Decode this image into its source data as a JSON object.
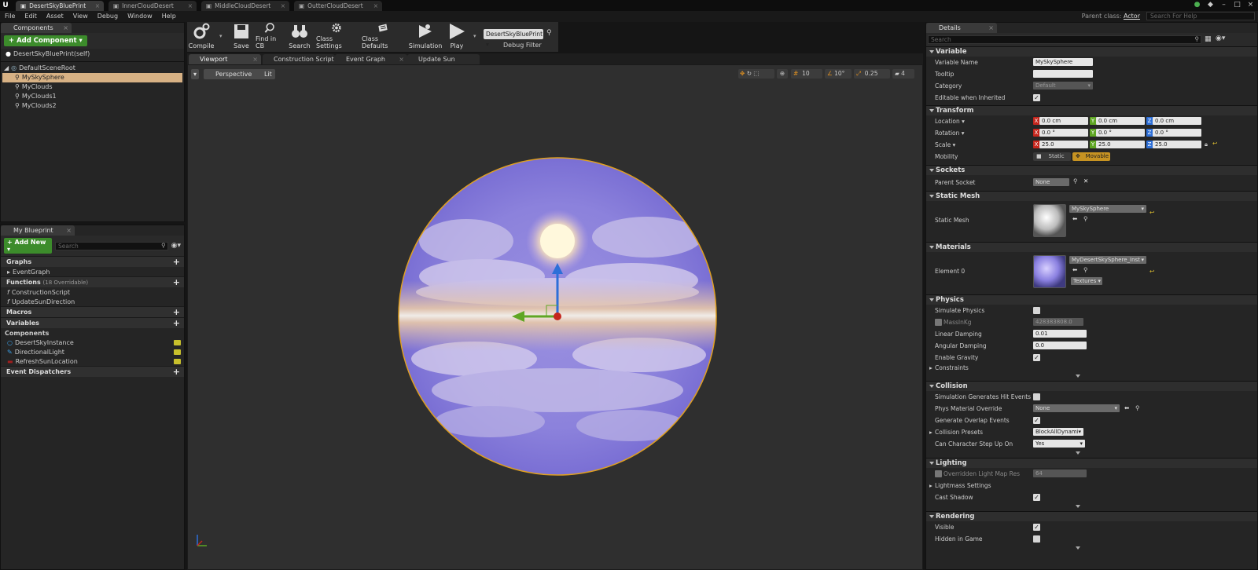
{
  "app": {
    "logo": "U"
  },
  "doc_tabs": [
    {
      "label": "DesertSkyBluePrint",
      "active": true
    },
    {
      "label": "InnerCloudDesert",
      "active": false
    },
    {
      "label": "MiddleCloudDesert",
      "active": false
    },
    {
      "label": "OutterCloudDesert",
      "active": false
    }
  ],
  "menu": [
    "File",
    "Edit",
    "Asset",
    "View",
    "Debug",
    "Window",
    "Help"
  ],
  "parent_class": {
    "label": "Parent class:",
    "value": "Actor"
  },
  "help_search_placeholder": "Search For Help",
  "components": {
    "tab": "Components",
    "add_button": "+ Add Component ▾",
    "self_item": "DesertSkyBluePrint(self)",
    "root": "DefaultSceneRoot",
    "children": [
      "MySkySphere",
      "MyClouds",
      "MyClouds1",
      "MyClouds2"
    ],
    "selected": "MySkySphere"
  },
  "blueprint": {
    "tab": "My Blueprint",
    "add_new": "+ Add New ▾",
    "search_placeholder": "Search",
    "graphs_label": "Graphs",
    "event_graph": "EventGraph",
    "functions_label": "Functions",
    "functions_note": "(18 Overridable)",
    "functions": [
      "ConstructionScript",
      "UpdateSunDirection"
    ],
    "macros_label": "Macros",
    "variables_label": "Variables",
    "components_group": "Components",
    "variables": [
      "DesertSkyInstance",
      "DirectionalLight",
      "RefreshSunLocation"
    ],
    "dispatchers_label": "Event Dispatchers"
  },
  "toolbar": {
    "compile": "Compile",
    "save": "Save",
    "find_in_cb": "Find in CB",
    "search": "Search",
    "class_settings": "Class Settings",
    "class_defaults": "Class Defaults",
    "simulation": "Simulation",
    "play": "Play",
    "debug_object": "DesertSkyBluePrint ▾",
    "debug_filter": "Debug Filter"
  },
  "editor_tabs": [
    "Viewport",
    "Construction Script",
    "Event Graph",
    "Update Sun Directio"
  ],
  "viewport": {
    "perspective": "Perspective",
    "lit": "Lit",
    "grid_snap": "10",
    "rot_snap": "10°",
    "scale_snap": "0.25",
    "camera_speed": "4"
  },
  "details": {
    "tab": "Details",
    "search_placeholder": "Search",
    "variable": {
      "title": "Variable",
      "name_label": "Variable Name",
      "name_value": "MySkySphere",
      "tooltip_label": "Tooltip",
      "tooltip_value": "",
      "category_label": "Category",
      "category_value": "Default",
      "editable_label": "Editable when Inherited"
    },
    "transform": {
      "title": "Transform",
      "location_label": "Location ▾",
      "location": [
        "0.0 cm",
        "0.0 cm",
        "0.0 cm"
      ],
      "rotation_label": "Rotation ▾",
      "rotation": [
        "0.0 °",
        "0.0 °",
        "0.0 °"
      ],
      "scale_label": "Scale ▾",
      "scale": [
        "25.0",
        "25.0",
        "25.0"
      ],
      "mobility_label": "Mobility",
      "static": "Static",
      "movable": "Movable"
    },
    "sockets": {
      "title": "Sockets",
      "parent_label": "Parent Socket",
      "parent_value": "None"
    },
    "static_mesh": {
      "title": "Static Mesh",
      "label": "Static Mesh",
      "value": "MySkySphere"
    },
    "materials": {
      "title": "Materials",
      "label": "Element 0",
      "value": "MyDesertSkySphere_Inst",
      "textures": "Textures ▾"
    },
    "physics": {
      "title": "Physics",
      "simulate": "Simulate Physics",
      "mass_label": "MassInKg",
      "mass_value": "428383808.0",
      "linear_label": "Linear Damping",
      "linear_value": "0.01",
      "angular_label": "Angular Damping",
      "angular_value": "0.0",
      "gravity_label": "Enable Gravity",
      "constraints_label": "Constraints"
    },
    "collision": {
      "title": "Collision",
      "hit_label": "Simulation Generates Hit Events",
      "phys_label": "Phys Material Override",
      "phys_value": "None",
      "overlap_label": "Generate Overlap Events",
      "presets_label": "Collision Presets",
      "presets_value": "BlockAllDynamic",
      "stepup_label": "Can Character Step Up On",
      "stepup_value": "Yes"
    },
    "lighting": {
      "title": "Lighting",
      "lightmap_label": "Overridden Light Map Res",
      "lightmap_value": "64",
      "lightmass_label": "Lightmass Settings",
      "shadow_label": "Cast Shadow"
    },
    "rendering": {
      "title": "Rendering",
      "visible_label": "Visible",
      "hidden_label": "Hidden in Game"
    }
  },
  "colors": {
    "accent_green": "#3c8c2b",
    "selection": "#d7b184",
    "movable": "#c79322",
    "sphere_outline": "#e0a020"
  }
}
